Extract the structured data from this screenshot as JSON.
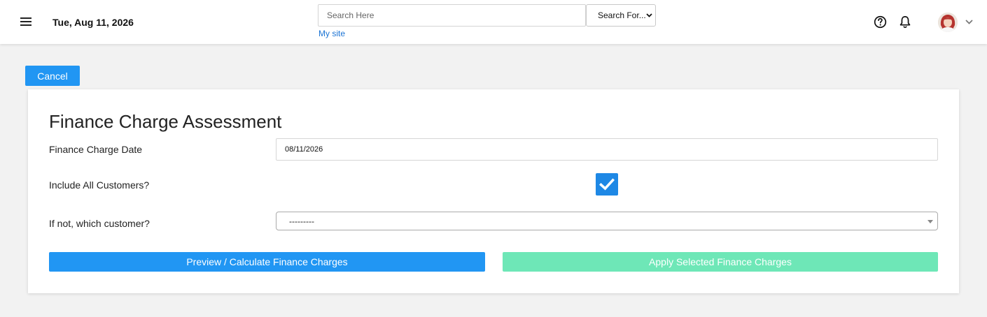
{
  "header": {
    "date": "Tue, Aug 11, 2026",
    "search_placeholder": "Search Here",
    "search_scope_label": "Search For...",
    "my_site_link": "My site",
    "icons": [
      "menu-icon",
      "help-icon",
      "bell-icon",
      "avatar",
      "chevron-down-icon"
    ]
  },
  "actions": {
    "cancel_label": "Cancel"
  },
  "form": {
    "title": "Finance Charge Assessment",
    "finance_charge_date_label": "Finance Charge Date",
    "finance_charge_date_value": "08/11/2026",
    "include_all_label": "Include All Customers?",
    "include_all_checked": true,
    "which_customer_label": "If not, which customer?",
    "which_customer_value": "---------",
    "preview_label": "Preview / Calculate Finance Charges",
    "apply_label": "Apply Selected Finance Charges"
  },
  "colors": {
    "primary": "#2196f3",
    "checkbox": "#1e88e5",
    "apply_disabled": "#6ee7b7",
    "link": "#1a73d4"
  }
}
